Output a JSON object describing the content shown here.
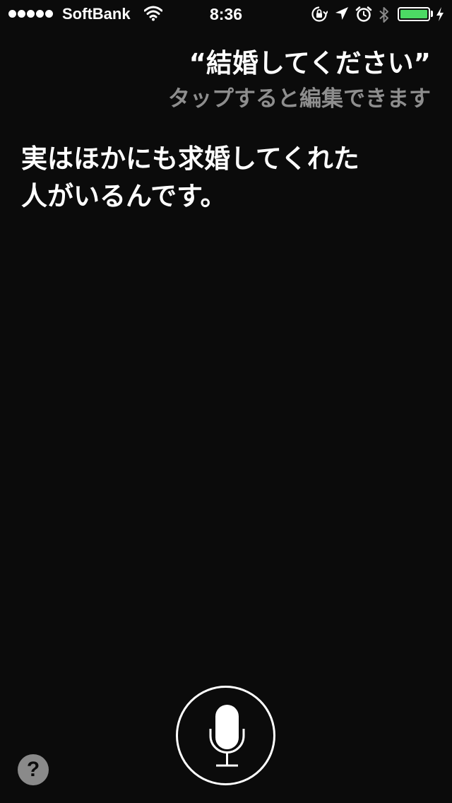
{
  "status_bar": {
    "signal_dots": 5,
    "carrier": "SoftBank",
    "time": "8:36",
    "icons": [
      "wifi-icon",
      "orientation-lock-icon",
      "location-arrow-icon",
      "alarm-icon",
      "bluetooth-icon",
      "battery-icon",
      "charging-bolt-icon"
    ],
    "battery_level": 1.0,
    "battery_color": "#4cd964"
  },
  "siri": {
    "query": "“結婚してください”",
    "edit_hint": "タップすると編集できます",
    "response_lines": [
      "実はほかにも求婚してくれた",
      "人がいるんです。"
    ]
  },
  "controls": {
    "mic_icon": "microphone-icon",
    "help_label": "?"
  },
  "colors": {
    "background": "#0b0b0b",
    "text": "#ffffff",
    "hint": "#8e8e8e",
    "help_bg": "#8a8a8a"
  }
}
